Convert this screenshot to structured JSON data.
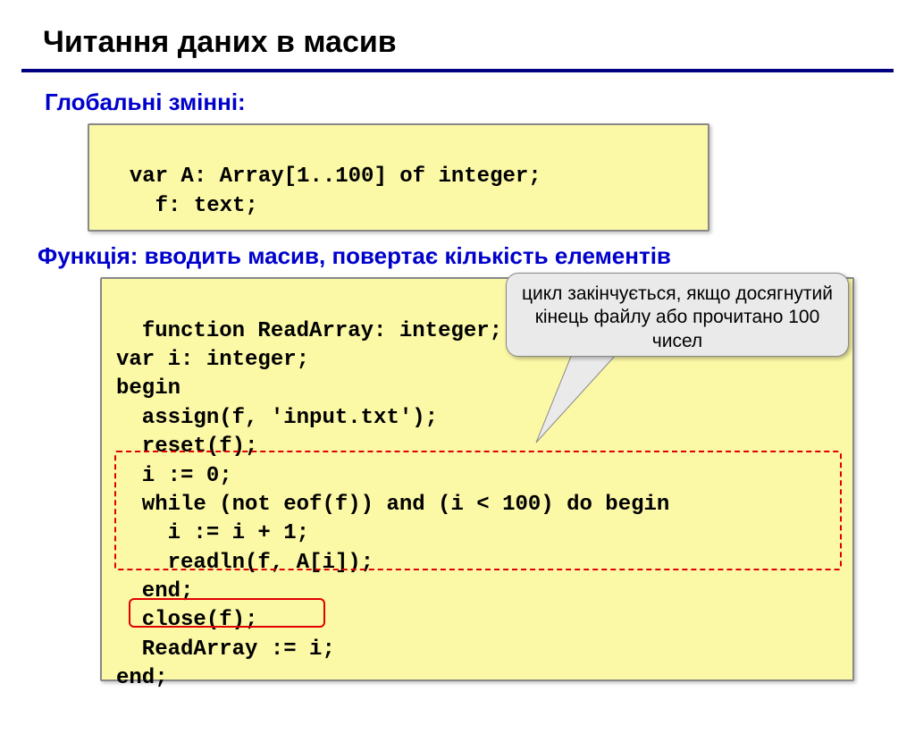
{
  "title": "Читання даних в масив",
  "subhead1": "Глобальні змінні:",
  "globals_code": "var A: Array[1..100] of integer;\n    f: text;",
  "subhead2": "Функція: вводить масив, повертає кількість елементів",
  "func_code": "function ReadArray: integer;\nvar i: integer;\nbegin\n  assign(f, 'input.txt');\n  reset(f);\n  i := 0;\n  while (not eof(f)) and (i < 100) do begin\n    i := i + 1;\n    readln(f, A[i]);\n  end;\n  close(f);\n  ReadArray := i;\nend;",
  "callout": "цикл закінчується, якщо досягнутий кінець файлу або прочитано 100 чисел"
}
